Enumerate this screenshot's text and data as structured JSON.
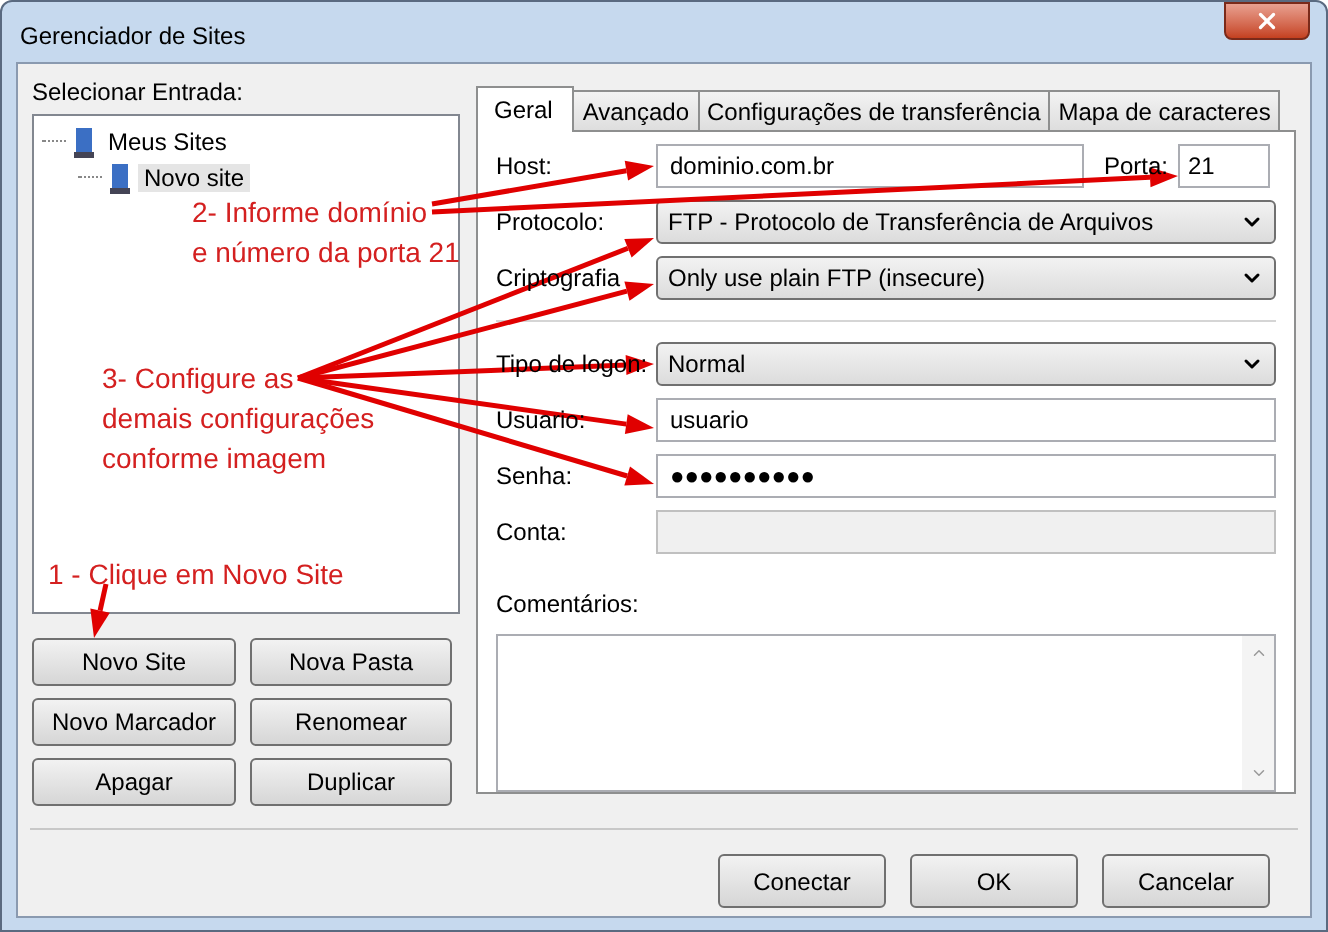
{
  "window": {
    "title": "Gerenciador de Sites"
  },
  "site_list": {
    "label": "Selecionar Entrada:",
    "tree": [
      {
        "label": "Meus Sites",
        "expanded": true,
        "selected": false,
        "children": [
          {
            "label": "Novo site",
            "selected": true
          }
        ]
      }
    ]
  },
  "site_buttons": [
    "Novo Site",
    "Nova Pasta",
    "Novo Marcador",
    "Renomear",
    "Apagar",
    "Duplicar"
  ],
  "tabs": [
    {
      "label": "Geral",
      "selected": true
    },
    {
      "label": "Avançado",
      "selected": false
    },
    {
      "label": "Configurações de transferência",
      "selected": false
    },
    {
      "label": "Mapa de caracteres",
      "selected": false
    }
  ],
  "host": {
    "label": "Host:",
    "value": "dominio.com.br"
  },
  "port": {
    "label": "Porta:",
    "value": "21"
  },
  "connection_fields": [
    {
      "kind": "select",
      "label": "Protocolo:",
      "value": "FTP - Protocolo de Transferência de Arquivos"
    },
    {
      "kind": "select",
      "label": "Criptografia",
      "value": "Only use plain FTP (insecure)"
    }
  ],
  "login_fields": [
    {
      "kind": "select",
      "label": "Tipo de logon:",
      "value": "Normal"
    },
    {
      "kind": "input",
      "label": "Usuario:",
      "value": "usuario"
    },
    {
      "kind": "input",
      "label": "Senha:",
      "value": "●●●●●●●●●●"
    },
    {
      "kind": "disabled",
      "label": "Conta:"
    }
  ],
  "comments": {
    "label": "Comentários:"
  },
  "footer_buttons": [
    "Conectar",
    "OK",
    "Cancelar"
  ],
  "annotations": [
    {
      "lines": [
        "2- Informe domínio",
        "e número da porta 21"
      ]
    },
    {
      "lines": [
        "3- Configure as",
        "demais configurações",
        "conforme imagem"
      ]
    },
    {
      "lines": [
        "1 - Clique em Novo Site"
      ]
    }
  ]
}
